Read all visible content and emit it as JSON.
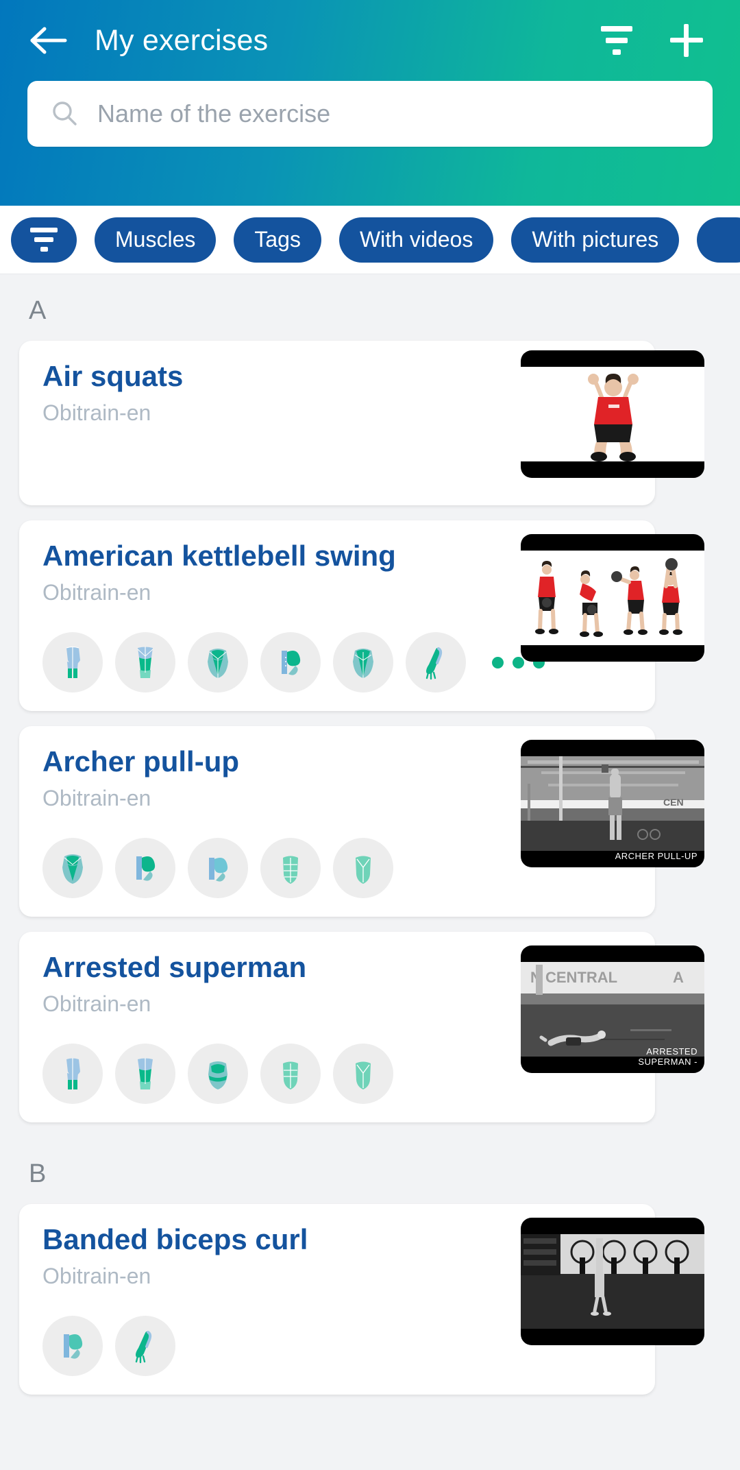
{
  "header": {
    "back_icon": "arrow-left-icon",
    "title": "My exercises",
    "filter_icon": "filter-icon",
    "add_icon": "plus-icon",
    "search": {
      "icon": "search-icon",
      "value": "",
      "placeholder": "Name of the exercise"
    },
    "gradient_from": "#0277bd",
    "gradient_to": "#10c08f"
  },
  "filter_chips": {
    "icon_chip": "filter-icon",
    "chip_color": "#14539e",
    "items": [
      {
        "label": "Muscles"
      },
      {
        "label": "Tags"
      },
      {
        "label": "With videos"
      },
      {
        "label": "With pictures"
      },
      {
        "label": ""
      }
    ]
  },
  "sections": [
    {
      "letter": "A",
      "exercises": [
        {
          "title": "Air squats",
          "subtitle": "Obitrain-en",
          "muscles": [],
          "more": false,
          "thumb": {
            "kind": "photo-white",
            "caption": ""
          }
        },
        {
          "title": "American kettlebell swing",
          "subtitle": "Obitrain-en",
          "muscles": [
            "legs-back-icon",
            "legs-front-icon",
            "torso-front-icon",
            "arm-biceps-icon",
            "torso-back-icon",
            "forearm-icon"
          ],
          "more": true,
          "thumb": {
            "kind": "photo-white-series",
            "caption": ""
          }
        },
        {
          "title": "Archer pull-up",
          "subtitle": "Obitrain-en",
          "muscles": [
            "torso-front-icon",
            "arm-biceps-icon",
            "arm-biceps-icon",
            "abs-icon",
            "abs-lower-icon"
          ],
          "more": false,
          "thumb": {
            "kind": "gym-bw-pullup",
            "caption": "ARCHER PULL-UP"
          }
        },
        {
          "title": "Arrested superman",
          "subtitle": "Obitrain-en",
          "muscles": [
            "legs-back-icon",
            "legs-front-icon",
            "torso-collar-icon",
            "abs-icon",
            "abs-lower-icon"
          ],
          "more": false,
          "thumb": {
            "kind": "gym-bw-floor",
            "caption": "ARRESTED\nSUPERMAN -"
          }
        }
      ]
    },
    {
      "letter": "B",
      "exercises": [
        {
          "title": "Banded biceps curl",
          "subtitle": "Obitrain-en",
          "muscles": [
            "arm-biceps-icon",
            "forearm-icon"
          ],
          "more": false,
          "thumb": {
            "kind": "gym-bw-standing",
            "caption": ""
          }
        }
      ]
    }
  ],
  "colors": {
    "title_blue": "#14539e",
    "subtitle_grey": "#aeb9c4",
    "section_letter_grey": "#7d858d",
    "page_bg": "#f2f3f5",
    "muscle_green": "#0db487",
    "muscle_blue": "#7fb6dd"
  }
}
